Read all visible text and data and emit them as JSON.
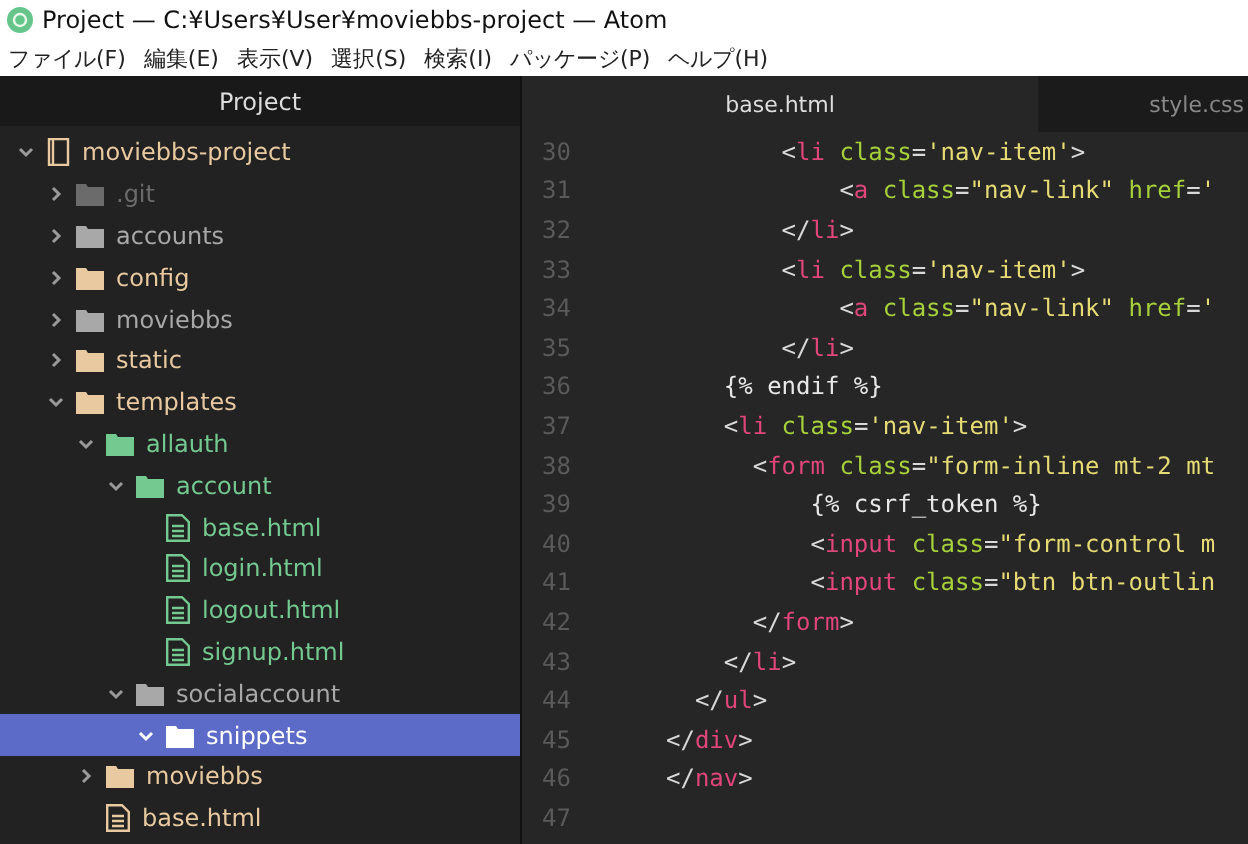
{
  "window": {
    "title": "Project — C:¥Users¥User¥moviebbs-project — Atom"
  },
  "menu": [
    "ファイル(F)",
    "編集(E)",
    "表示(V)",
    "選択(S)",
    "検索(I)",
    "パッケージ(P)",
    "ヘルプ(H)"
  ],
  "sidebar": {
    "title": "Project",
    "tree": [
      {
        "name": "moviebbs-project",
        "kind": "project",
        "expanded": true,
        "selected": false,
        "color": "#e8c9a0",
        "children": [
          {
            "name": ".git",
            "kind": "folder",
            "expanded": false,
            "selected": false,
            "color": "#6b6b6b"
          },
          {
            "name": "accounts",
            "kind": "folder",
            "expanded": false,
            "selected": false,
            "color": "#a8a8a8"
          },
          {
            "name": "config",
            "kind": "folder",
            "expanded": false,
            "selected": false,
            "color": "#e8c9a0"
          },
          {
            "name": "moviebbs",
            "kind": "folder",
            "expanded": false,
            "selected": false,
            "color": "#a8a8a8"
          },
          {
            "name": "static",
            "kind": "folder",
            "expanded": false,
            "selected": false,
            "color": "#e8c9a0"
          },
          {
            "name": "templates",
            "kind": "folder",
            "expanded": true,
            "selected": false,
            "color": "#e8c9a0",
            "children": [
              {
                "name": "allauth",
                "kind": "folder",
                "expanded": true,
                "selected": false,
                "color": "#73c990",
                "children": [
                  {
                    "name": "account",
                    "kind": "folder",
                    "expanded": true,
                    "selected": false,
                    "color": "#73c990",
                    "children": [
                      {
                        "name": "base.html",
                        "kind": "file",
                        "selected": false,
                        "color": "#73c990"
                      },
                      {
                        "name": "login.html",
                        "kind": "file",
                        "selected": false,
                        "color": "#73c990"
                      },
                      {
                        "name": "logout.html",
                        "kind": "file",
                        "selected": false,
                        "color": "#73c990"
                      },
                      {
                        "name": "signup.html",
                        "kind": "file",
                        "selected": false,
                        "color": "#73c990"
                      }
                    ]
                  },
                  {
                    "name": "socialaccount",
                    "kind": "folder",
                    "expanded": true,
                    "selected": false,
                    "color": "#a8a8a8",
                    "children": [
                      {
                        "name": "snippets",
                        "kind": "folder",
                        "expanded": true,
                        "selected": true,
                        "color": "#ffffff"
                      }
                    ]
                  }
                ]
              },
              {
                "name": "moviebbs",
                "kind": "folder",
                "expanded": false,
                "selected": false,
                "color": "#e8c9a0"
              },
              {
                "name": "base.html",
                "kind": "file",
                "selected": false,
                "color": "#e8c9a0"
              }
            ]
          }
        ]
      }
    ]
  },
  "tabs": [
    {
      "label": "base.html",
      "selected": true
    },
    {
      "label": "style.css",
      "selected": false
    }
  ],
  "code": [
    {
      "number": "30",
      "tokens": [
        {
          "kind": "punct",
          "text": "        <"
        },
        {
          "kind": "tag",
          "text": "li"
        },
        {
          "kind": "attr",
          "text": " class"
        },
        {
          "kind": "punct",
          "text": "="
        },
        {
          "kind": "string",
          "text": "'nav-item'"
        },
        {
          "kind": "punct",
          "text": ">"
        }
      ]
    },
    {
      "number": "31",
      "tokens": [
        {
          "kind": "punct",
          "text": "            <"
        },
        {
          "kind": "tag",
          "text": "a"
        },
        {
          "kind": "attr",
          "text": " class"
        },
        {
          "kind": "punct",
          "text": "="
        },
        {
          "kind": "string",
          "text": "\"nav-link\""
        },
        {
          "kind": "attr",
          "text": " href"
        },
        {
          "kind": "punct",
          "text": "="
        },
        {
          "kind": "string",
          "text": "'"
        }
      ]
    },
    {
      "number": "32",
      "tokens": [
        {
          "kind": "punct",
          "text": "        </"
        },
        {
          "kind": "tag",
          "text": "li"
        },
        {
          "kind": "punct",
          "text": ">"
        }
      ]
    },
    {
      "number": "33",
      "tokens": [
        {
          "kind": "punct",
          "text": "        <"
        },
        {
          "kind": "tag",
          "text": "li"
        },
        {
          "kind": "attr",
          "text": " class"
        },
        {
          "kind": "punct",
          "text": "="
        },
        {
          "kind": "string",
          "text": "'nav-item'"
        },
        {
          "kind": "punct",
          "text": ">"
        }
      ]
    },
    {
      "number": "34",
      "tokens": [
        {
          "kind": "punct",
          "text": "            <"
        },
        {
          "kind": "tag",
          "text": "a"
        },
        {
          "kind": "attr",
          "text": " class"
        },
        {
          "kind": "punct",
          "text": "="
        },
        {
          "kind": "string",
          "text": "\"nav-link\""
        },
        {
          "kind": "attr",
          "text": " href"
        },
        {
          "kind": "punct",
          "text": "="
        },
        {
          "kind": "string",
          "text": "'"
        }
      ]
    },
    {
      "number": "35",
      "tokens": [
        {
          "kind": "punct",
          "text": "        </"
        },
        {
          "kind": "tag",
          "text": "li"
        },
        {
          "kind": "punct",
          "text": ">"
        }
      ]
    },
    {
      "number": "36",
      "tokens": [
        {
          "kind": "template",
          "text": "    {% endif %}"
        }
      ]
    },
    {
      "number": "37",
      "tokens": [
        {
          "kind": "punct",
          "text": "    <"
        },
        {
          "kind": "tag",
          "text": "li"
        },
        {
          "kind": "attr",
          "text": " class"
        },
        {
          "kind": "punct",
          "text": "="
        },
        {
          "kind": "string",
          "text": "'nav-item'"
        },
        {
          "kind": "punct",
          "text": ">"
        }
      ]
    },
    {
      "number": "38",
      "tokens": [
        {
          "kind": "punct",
          "text": "      <"
        },
        {
          "kind": "tag",
          "text": "form"
        },
        {
          "kind": "attr",
          "text": " class"
        },
        {
          "kind": "punct",
          "text": "="
        },
        {
          "kind": "string",
          "text": "\"form-inline mt-2 mt"
        }
      ]
    },
    {
      "number": "39",
      "tokens": [
        {
          "kind": "template",
          "text": "          {% csrf_token %}"
        }
      ]
    },
    {
      "number": "40",
      "tokens": [
        {
          "kind": "punct",
          "text": "          <"
        },
        {
          "kind": "tag",
          "text": "input"
        },
        {
          "kind": "attr",
          "text": " class"
        },
        {
          "kind": "punct",
          "text": "="
        },
        {
          "kind": "string",
          "text": "\"form-control m"
        }
      ]
    },
    {
      "number": "41",
      "tokens": [
        {
          "kind": "punct",
          "text": "          <"
        },
        {
          "kind": "tag",
          "text": "input"
        },
        {
          "kind": "attr",
          "text": " class"
        },
        {
          "kind": "punct",
          "text": "="
        },
        {
          "kind": "string",
          "text": "\"btn btn-outlin"
        }
      ]
    },
    {
      "number": "42",
      "tokens": [
        {
          "kind": "punct",
          "text": "      </"
        },
        {
          "kind": "tag",
          "text": "form"
        },
        {
          "kind": "punct",
          "text": ">"
        }
      ]
    },
    {
      "number": "43",
      "tokens": [
        {
          "kind": "punct",
          "text": "    </"
        },
        {
          "kind": "tag",
          "text": "li"
        },
        {
          "kind": "punct",
          "text": ">"
        }
      ]
    },
    {
      "number": "44",
      "tokens": [
        {
          "kind": "punct",
          "text": "  </"
        },
        {
          "kind": "tag",
          "text": "ul"
        },
        {
          "kind": "punct",
          "text": ">"
        }
      ]
    },
    {
      "number": "45",
      "tokens": [
        {
          "kind": "punct",
          "text": "</"
        },
        {
          "kind": "tag",
          "text": "div"
        },
        {
          "kind": "punct",
          "text": ">"
        }
      ]
    },
    {
      "number": "46",
      "tokens": [
        {
          "kind": "punct",
          "text": "</"
        },
        {
          "kind": "tag",
          "text": "nav"
        },
        {
          "kind": "punct",
          "text": ">"
        }
      ]
    },
    {
      "number": "47"
    }
  ]
}
